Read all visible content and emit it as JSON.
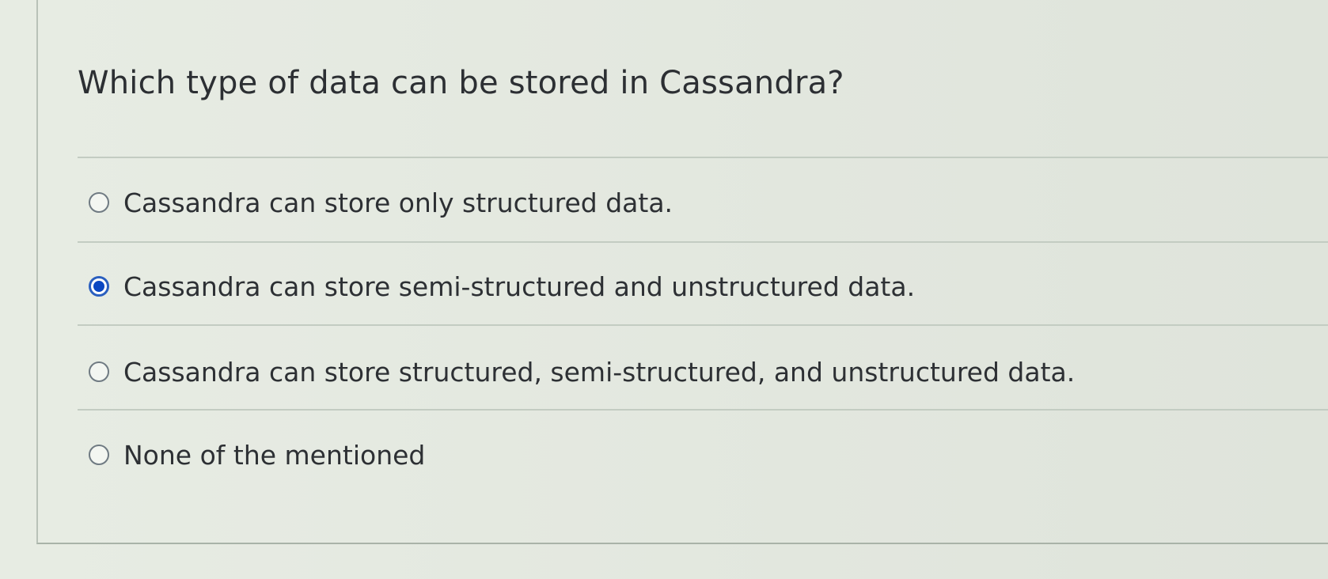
{
  "question": {
    "text": "Which type of data can be stored in Cassandra?"
  },
  "options": [
    {
      "label": "Cassandra can store only structured data.",
      "selected": false
    },
    {
      "label": "Cassandra can store semi-structured and unstructured data.",
      "selected": true
    },
    {
      "label": "Cassandra can store structured, semi-structured, and unstructured data.",
      "selected": false
    },
    {
      "label": "None of the mentioned",
      "selected": false
    }
  ],
  "colors": {
    "selected_radio": "#0a47c2",
    "text": "#2d3034",
    "background": "#e6ebe2"
  }
}
